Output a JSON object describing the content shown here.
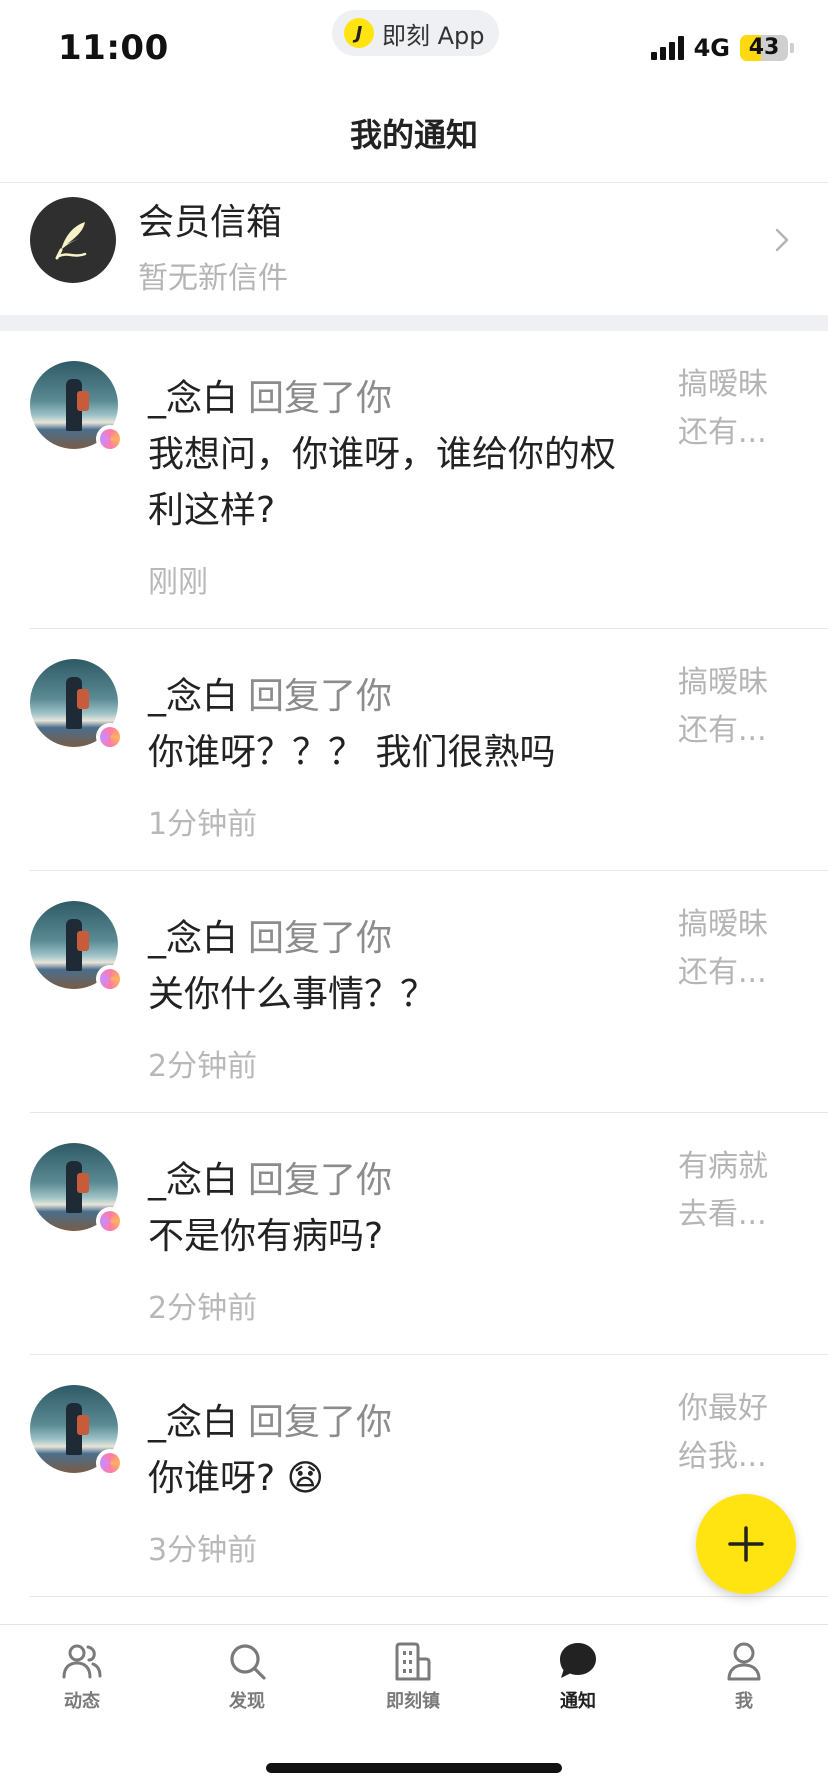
{
  "status_bar": {
    "time": "11:00",
    "app_pill_logo": "J",
    "app_pill_label": "即刻 App",
    "network": "4G",
    "battery": "43",
    "battery_level": 0.43
  },
  "header": {
    "title": "我的通知"
  },
  "mailbox": {
    "title": "会员信箱",
    "subtitle": "暂无新信件",
    "icon": "quill-icon"
  },
  "notifications": [
    {
      "user": "_念白",
      "action": "回复了你",
      "body": "我想问，你谁呀，谁给你的权利这样?",
      "time": "刚刚",
      "snippet": "搞暧昧还有..."
    },
    {
      "user": "_念白",
      "action": "回复了你",
      "body": "你谁呀？？？ 我们很熟吗",
      "time": "1分钟前",
      "snippet": "搞暧昧还有..."
    },
    {
      "user": "_念白",
      "action": "回复了你",
      "body": "关你什么事情？？",
      "time": "2分钟前",
      "snippet": "搞暧昧还有..."
    },
    {
      "user": "_念白",
      "action": "回复了你",
      "body": "不是你有病吗?",
      "time": "2分钟前",
      "snippet": "有病就去看..."
    },
    {
      "user": "_念白",
      "action": "回复了你",
      "body": "你谁呀? 😧",
      "time": "3分钟前",
      "snippet": "你最好给我..."
    }
  ],
  "fab": {
    "icon": "plus-icon"
  },
  "tabbar": {
    "tabs": [
      {
        "label": "动态",
        "icon": "people-icon",
        "active": false
      },
      {
        "label": "发现",
        "icon": "search-icon",
        "active": false
      },
      {
        "label": "即刻镇",
        "icon": "building-icon",
        "active": false
      },
      {
        "label": "通知",
        "icon": "chat-bubble-icon",
        "active": true
      },
      {
        "label": "我",
        "icon": "profile-icon",
        "active": false
      }
    ]
  },
  "colors": {
    "accent": "#ffe411",
    "text": "#222222",
    "muted": "#b5b5b5",
    "divider": "#e6e6e6"
  }
}
